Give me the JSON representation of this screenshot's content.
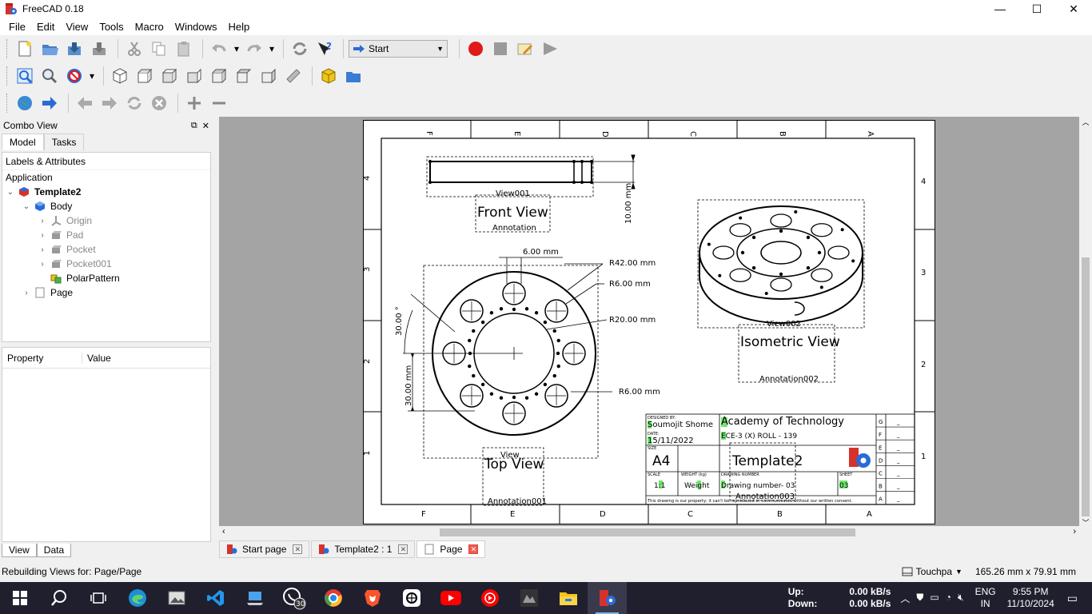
{
  "window": {
    "title": "FreeCAD 0.18",
    "min": "—",
    "max": "☐",
    "close": "✕"
  },
  "menu": [
    "File",
    "Edit",
    "View",
    "Tools",
    "Macro",
    "Windows",
    "Help"
  ],
  "toolbar": {
    "workbench": "Start"
  },
  "combo": {
    "title": "Combo View",
    "tabs": [
      "Model",
      "Tasks"
    ],
    "tree_header": "Labels & Attributes",
    "application": "Application",
    "items": [
      {
        "label": "Template2",
        "bold": true
      },
      {
        "label": "Body"
      },
      {
        "label": "Origin"
      },
      {
        "label": "Pad"
      },
      {
        "label": "Pocket"
      },
      {
        "label": "Pocket001"
      },
      {
        "label": "PolarPattern"
      },
      {
        "label": "Page"
      }
    ],
    "prop_headers": [
      "Property",
      "Value"
    ],
    "bottom_tabs": [
      "View",
      "Data"
    ]
  },
  "drawing": {
    "border_cols": [
      "F",
      "E",
      "D",
      "C",
      "B",
      "A"
    ],
    "border_rows": [
      "4",
      "3",
      "2",
      "1"
    ],
    "labels": {
      "view001": "View001",
      "front_view": "Front View",
      "annotation": "Annotation",
      "view002": "View002",
      "iso_view": "Isometric View",
      "annotation002": "Annotation002",
      "view": "View",
      "top_view": "Top View",
      "annotation001": "Annotation001",
      "annotation003": "Annotation003"
    },
    "dims": {
      "d_6": "6.00  mm",
      "d_10": "10.00  mm",
      "r42": "R42.00  mm",
      "r6a": "R6.00  mm",
      "r20": "R20.00  mm",
      "r6b": "R6.00  mm",
      "ang": "30.00  °",
      "d_30": "30.00  mm"
    },
    "title_block": {
      "designed_by_label": "DESIGNED BY:",
      "designed_by": "Soumojit Shome",
      "date_label": "DATE:",
      "date": "15/11/2022",
      "size_label": "SIZE",
      "size": "A4",
      "org": "Academy of Technology",
      "subtitle": "ECE-3 (X) ROLL - 139",
      "title": "Template2",
      "scale_label": "SCALE",
      "scale": "1:1",
      "weight_label": "WEIGHT (kg)",
      "weight": "Weight",
      "drawing_number_label": "DRAWING NUMBER",
      "drawing_number": "Drawing number- 03",
      "sheet_label": "SHEET",
      "sheet": "03",
      "footer": "This drawing is our property; it can't be reproduced or communicated without our written consent.",
      "revisions": [
        "G",
        "F",
        "E",
        "D",
        "C",
        "B",
        "A"
      ],
      "rev_value": "_"
    }
  },
  "mdi_tabs": [
    "Start page",
    "Template2 : 1",
    "Page"
  ],
  "status": {
    "message": "Rebuilding Views for: Page/Page",
    "nav": "Touchpa",
    "dims": "165.26 mm x 79.91 mm"
  },
  "taskbar": {
    "up_label": "Up:",
    "up_value": "0.00 kB/s",
    "down_label": "Down:",
    "down_value": "0.00 kB/s",
    "lang1": "ENG",
    "lang2": "IN",
    "time": "9:55 PM",
    "date": "11/10/2024",
    "whatsapp_badge": "30"
  }
}
